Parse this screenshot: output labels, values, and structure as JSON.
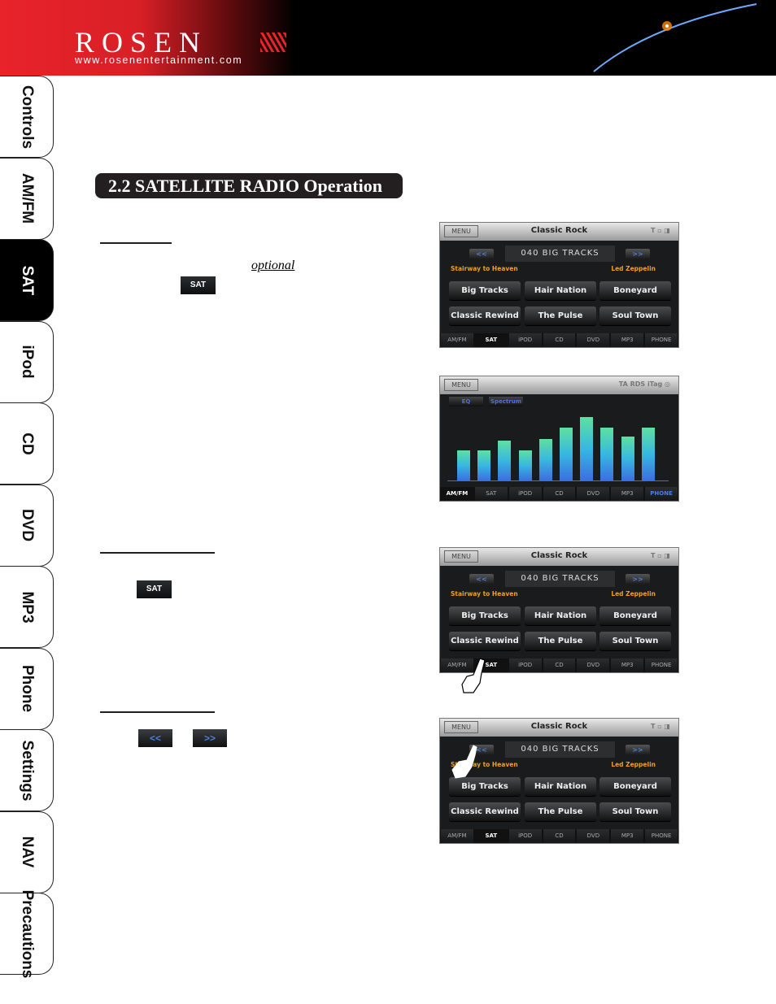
{
  "header": {
    "brand": "ROSEN",
    "url": "www.rosenentertainment.com"
  },
  "sidebar": {
    "tabs": [
      {
        "label": "Controls"
      },
      {
        "label": "AM/FM"
      },
      {
        "label": "SAT",
        "active": true
      },
      {
        "label": "iPod"
      },
      {
        "label": "CD"
      },
      {
        "label": "DVD"
      },
      {
        "label": "MP3"
      },
      {
        "label": "Phone"
      },
      {
        "label": "Settings"
      },
      {
        "label": "NAV"
      },
      {
        "label": "Precautions"
      }
    ]
  },
  "section": {
    "title": "2.2 SATELLITE RADIO Operation",
    "optional": "optional"
  },
  "inline_buttons": {
    "sat": "SAT",
    "prev": "<<",
    "next": ">>"
  },
  "radio_screen": {
    "menu": "MENU",
    "title": "Classic Rock",
    "status_icons": "T ▫ ◨",
    "prev": "<<",
    "next": ">>",
    "channel": "040 BIG TRACKS",
    "song": "Stairway to Heaven",
    "artist": "Led Zeppelin",
    "presets": [
      "Big Tracks",
      "Hair Nation",
      "Boneyard",
      "Classic Rewind",
      "The Pulse",
      "Soul Town"
    ],
    "tabs": [
      "AM/FM",
      "SAT",
      "iPOD",
      "CD",
      "DVD",
      "MP3",
      "PHONE"
    ],
    "active_tab": "SAT"
  },
  "spectrum_screen": {
    "menu": "MENU",
    "status_icons": "TA  RDS  iTag  ◎",
    "eq": "EQ",
    "spectrum": "Spectrum",
    "bar_levels": [
      0.47,
      0.47,
      0.63,
      0.47,
      0.65,
      0.83,
      1.0,
      0.83,
      0.69,
      0.83
    ],
    "tabs": [
      "AM/FM",
      "SAT",
      "iPOD",
      "CD",
      "DVD",
      "MP3",
      "PHONE"
    ],
    "active_tab": "AM/FM",
    "highlight_tab": "PHONE"
  },
  "colors": {
    "accent_red": "#e8232a",
    "song_orange": "#f0a020",
    "button_blue": "#4a7fe0"
  }
}
